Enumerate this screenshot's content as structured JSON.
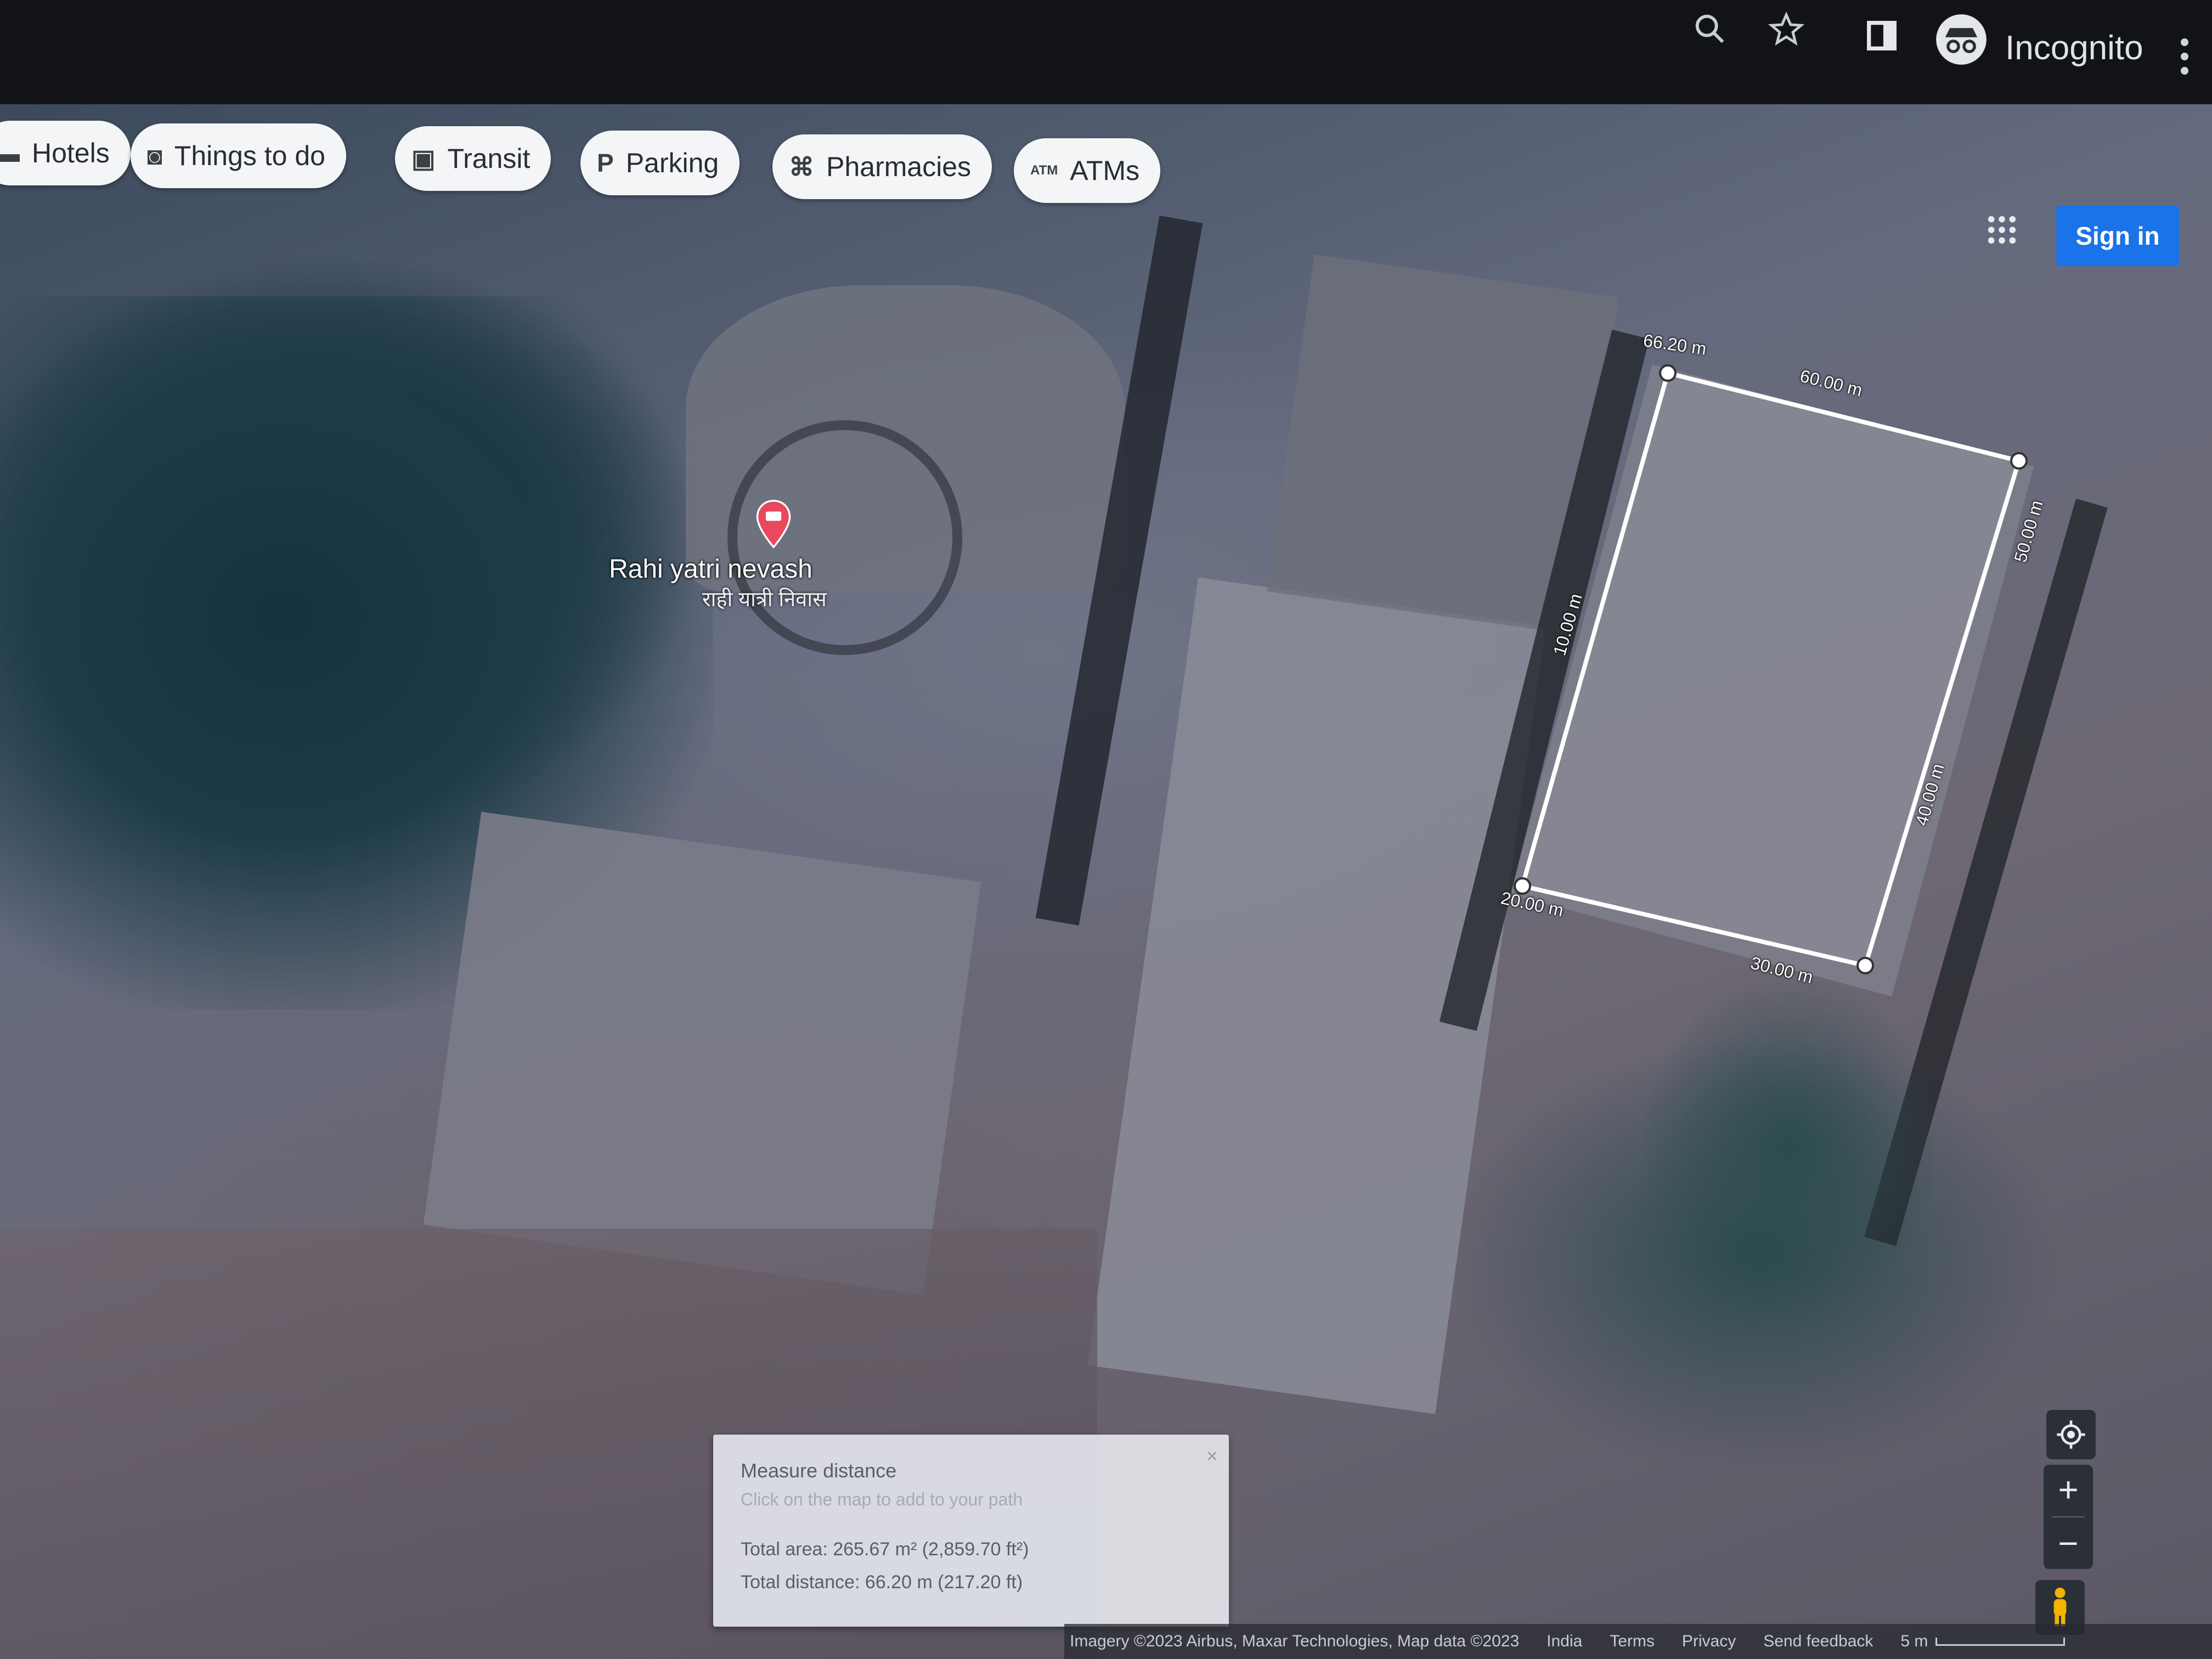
{
  "browser": {
    "incognito_label": "Incognito"
  },
  "categories": [
    {
      "label": "Hotels",
      "icon": "bed-icon"
    },
    {
      "label": "Things to do",
      "icon": "camera-icon"
    },
    {
      "label": "Transit",
      "icon": "bus-icon"
    },
    {
      "label": "Parking",
      "icon": "parking-icon"
    },
    {
      "label": "Pharmacies",
      "icon": "pharmacy-icon"
    },
    {
      "label": "ATMs",
      "icon": "atm-icon"
    }
  ],
  "header": {
    "sign_in_label": "Sign in"
  },
  "place": {
    "name": "Rahi yatri nevash",
    "name_local": "राही यात्री निवास",
    "pin_color": "#e8495e"
  },
  "measurement": {
    "segment_labels": [
      "66.20 m",
      "60.00 m",
      "50.00 m",
      "40.00 m",
      "30.00 m",
      "20.00 m",
      "10.00 m"
    ],
    "line_color": "#ffffff"
  },
  "measure_panel": {
    "title": "Measure distance",
    "hint": "Click on the map to add to your path",
    "total_area": "Total area: 265.67 m² (2,859.70 ft²)",
    "total_distance": "Total distance: 66.20 m (217.20 ft)",
    "close_symbol": "×"
  },
  "footer": {
    "imagery": "Imagery ©2023 Airbus, Maxar Technologies, Map data ©2023",
    "country": "India",
    "terms": "Terms",
    "privacy": "Privacy",
    "feedback": "Send feedback",
    "scale": "5 m"
  },
  "colors": {
    "sign_in": "#1a73e8",
    "chip_bg": "#f4f5f7"
  }
}
